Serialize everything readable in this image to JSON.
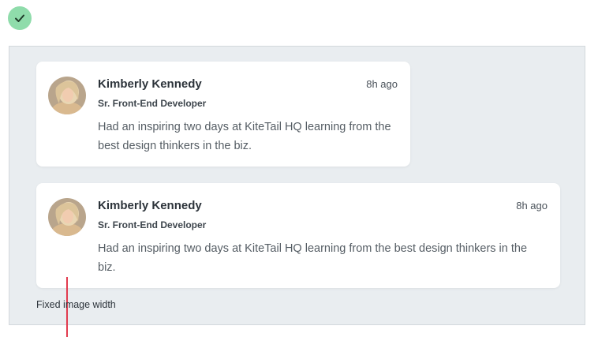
{
  "status": {
    "icon": "checkmark-icon",
    "color": "#8fdcab"
  },
  "cards": [
    {
      "name": "Kimberly Kennedy",
      "role": "Sr. Front-End Developer",
      "time": "8h ago",
      "message": "Had an inspiring two days at KiteTail HQ learning from the best design thinkers in the biz."
    },
    {
      "name": "Kimberly Kennedy",
      "role": "Sr. Front-End Developer",
      "time": "8h ago",
      "message": "Had an inspiring two days at KiteTail HQ learning from the best design thinkers in the biz."
    }
  ],
  "annotation": {
    "label": "Fixed image width",
    "color": "#e23b4f"
  }
}
